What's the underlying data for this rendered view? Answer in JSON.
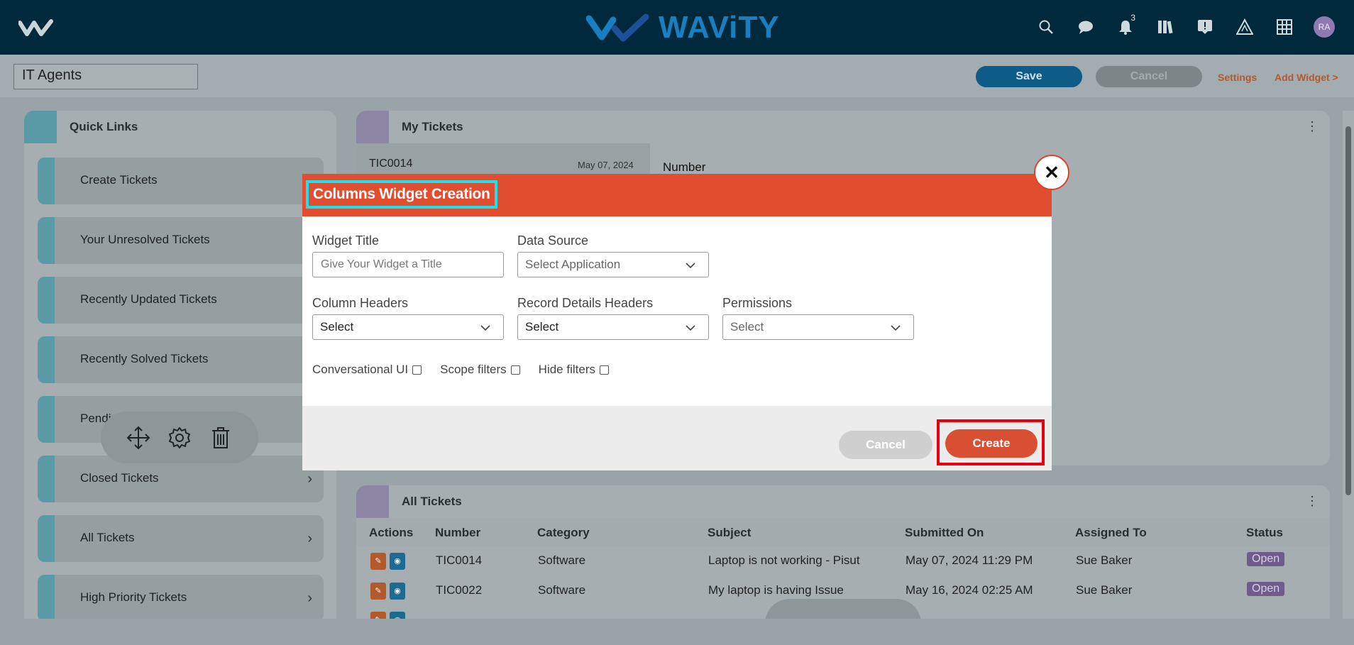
{
  "app": {
    "brand": "WAViTY",
    "notifications_count": "3",
    "avatar_initials": "RA"
  },
  "toolbar": {
    "dashboard_title": "IT Agents",
    "save_label": "Save",
    "cancel_label": "Cancel",
    "settings_label": "Settings",
    "add_widget_label": "Add Widget >"
  },
  "quick_links": {
    "title": "Quick Links",
    "items": [
      {
        "label": "Create Tickets"
      },
      {
        "label": "Your Unresolved Tickets"
      },
      {
        "label": "Recently Updated Tickets"
      },
      {
        "label": "Recently Solved Tickets"
      },
      {
        "label": "Pending T"
      },
      {
        "label": "Closed Tickets"
      },
      {
        "label": "All Tickets"
      },
      {
        "label": "High Priority Tickets"
      }
    ]
  },
  "my_tickets": {
    "title": "My Tickets",
    "first_number": "TIC0014",
    "first_date": "May 07, 2024",
    "detail_label": "Number"
  },
  "all_tickets": {
    "title": "All Tickets",
    "columns": [
      "Actions",
      "Number",
      "Category",
      "Subject",
      "Submitted On",
      "Assigned To",
      "Status"
    ],
    "rows": [
      {
        "number": "TIC0014",
        "category": "Software",
        "subject": "Laptop is not working - Pisut",
        "submitted_on": "May 07, 2024 11:29 PM",
        "assigned_to": "Sue Baker",
        "status": "Open"
      },
      {
        "number": "TIC0022",
        "category": "Software",
        "subject": "My laptop is having Issue",
        "submitted_on": "May 16, 2024 02:25 AM",
        "assigned_to": "Sue Baker",
        "status": "Open"
      }
    ]
  },
  "modal": {
    "title": "Columns Widget Creation",
    "widget_title_label": "Widget Title",
    "widget_title_placeholder": "Give Your Widget a Title",
    "data_source_label": "Data Source",
    "data_source_value": "Select Application",
    "column_headers_label": "Column Headers",
    "column_headers_value": "Select",
    "record_details_label": "Record Details Headers",
    "record_details_value": "Select",
    "permissions_label": "Permissions",
    "permissions_value": "Select",
    "conversational_ui_label": "Conversational UI",
    "scope_filters_label": "Scope filters",
    "hide_filters_label": "Hide filters",
    "cancel_label": "Cancel",
    "create_label": "Create"
  },
  "colors": {
    "navbar": "#002a3b",
    "modal_header": "#e04e2f",
    "title_highlight": "#1ee0e8",
    "create_highlight": "#e8000f",
    "save_button": "#0f5b87"
  }
}
